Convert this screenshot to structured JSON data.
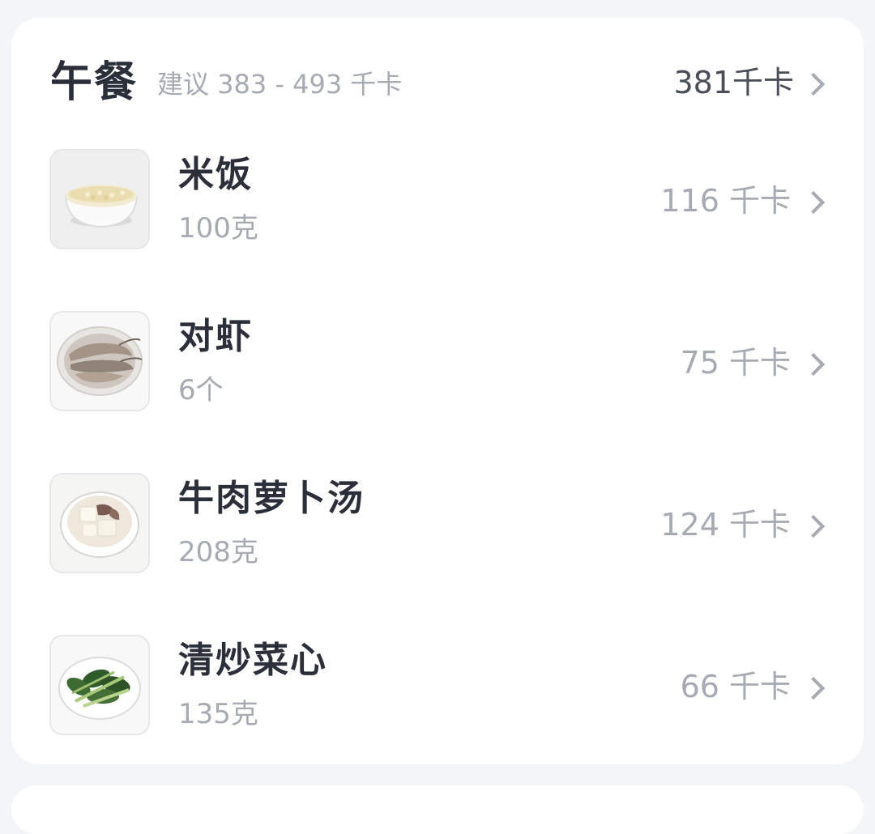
{
  "meal": {
    "title": "午餐",
    "suggestion": "建议 383 - 493 千卡",
    "total": "381千卡"
  },
  "items": [
    {
      "name": "米饭",
      "amount": "100克",
      "calories": "116 千卡",
      "image": "rice-bowl"
    },
    {
      "name": "对虾",
      "amount": "6个",
      "calories": "75 千卡",
      "image": "shrimp-plate"
    },
    {
      "name": "牛肉萝卜汤",
      "amount": "208克",
      "calories": "124 千卡",
      "image": "beef-radish-soup"
    },
    {
      "name": "清炒菜心",
      "amount": "135克",
      "calories": "66 千卡",
      "image": "stir-fried-greens"
    }
  ],
  "icons": {
    "row_chevron": "chevron-right-icon"
  },
  "colors": {
    "title": "#2B2F3A",
    "muted": "#A6AAB3",
    "background": "#F4F5F9",
    "card": "#FFFFFF"
  }
}
